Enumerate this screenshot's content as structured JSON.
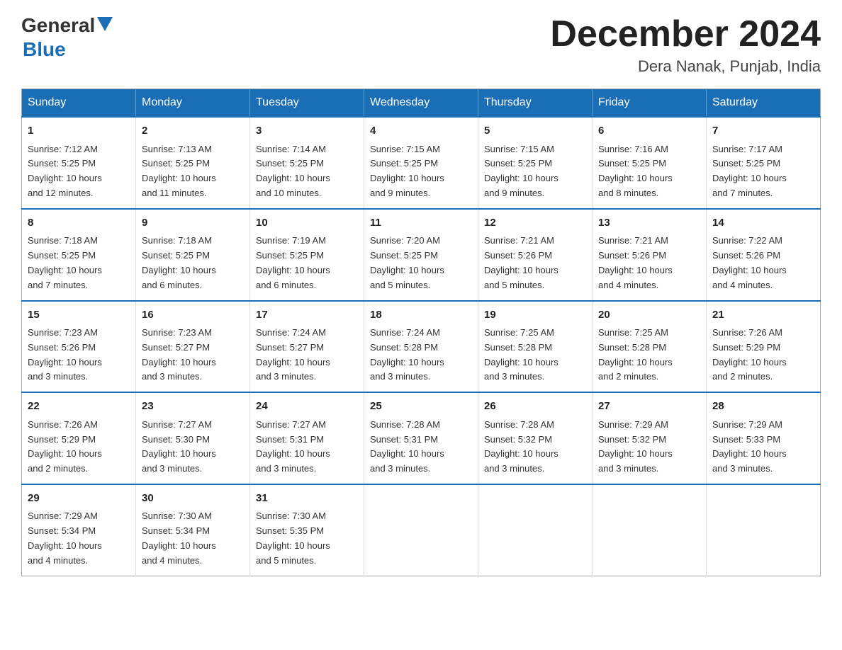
{
  "header": {
    "logo_general": "General",
    "logo_blue": "Blue",
    "month_title": "December 2024",
    "location": "Dera Nanak, Punjab, India"
  },
  "days_of_week": [
    "Sunday",
    "Monday",
    "Tuesday",
    "Wednesday",
    "Thursday",
    "Friday",
    "Saturday"
  ],
  "weeks": [
    [
      {
        "date": "1",
        "sunrise": "7:12 AM",
        "sunset": "5:25 PM",
        "daylight": "10 hours and 12 minutes."
      },
      {
        "date": "2",
        "sunrise": "7:13 AM",
        "sunset": "5:25 PM",
        "daylight": "10 hours and 11 minutes."
      },
      {
        "date": "3",
        "sunrise": "7:14 AM",
        "sunset": "5:25 PM",
        "daylight": "10 hours and 10 minutes."
      },
      {
        "date": "4",
        "sunrise": "7:15 AM",
        "sunset": "5:25 PM",
        "daylight": "10 hours and 9 minutes."
      },
      {
        "date": "5",
        "sunrise": "7:15 AM",
        "sunset": "5:25 PM",
        "daylight": "10 hours and 9 minutes."
      },
      {
        "date": "6",
        "sunrise": "7:16 AM",
        "sunset": "5:25 PM",
        "daylight": "10 hours and 8 minutes."
      },
      {
        "date": "7",
        "sunrise": "7:17 AM",
        "sunset": "5:25 PM",
        "daylight": "10 hours and 7 minutes."
      }
    ],
    [
      {
        "date": "8",
        "sunrise": "7:18 AM",
        "sunset": "5:25 PM",
        "daylight": "10 hours and 7 minutes."
      },
      {
        "date": "9",
        "sunrise": "7:18 AM",
        "sunset": "5:25 PM",
        "daylight": "10 hours and 6 minutes."
      },
      {
        "date": "10",
        "sunrise": "7:19 AM",
        "sunset": "5:25 PM",
        "daylight": "10 hours and 6 minutes."
      },
      {
        "date": "11",
        "sunrise": "7:20 AM",
        "sunset": "5:25 PM",
        "daylight": "10 hours and 5 minutes."
      },
      {
        "date": "12",
        "sunrise": "7:21 AM",
        "sunset": "5:26 PM",
        "daylight": "10 hours and 5 minutes."
      },
      {
        "date": "13",
        "sunrise": "7:21 AM",
        "sunset": "5:26 PM",
        "daylight": "10 hours and 4 minutes."
      },
      {
        "date": "14",
        "sunrise": "7:22 AM",
        "sunset": "5:26 PM",
        "daylight": "10 hours and 4 minutes."
      }
    ],
    [
      {
        "date": "15",
        "sunrise": "7:23 AM",
        "sunset": "5:26 PM",
        "daylight": "10 hours and 3 minutes."
      },
      {
        "date": "16",
        "sunrise": "7:23 AM",
        "sunset": "5:27 PM",
        "daylight": "10 hours and 3 minutes."
      },
      {
        "date": "17",
        "sunrise": "7:24 AM",
        "sunset": "5:27 PM",
        "daylight": "10 hours and 3 minutes."
      },
      {
        "date": "18",
        "sunrise": "7:24 AM",
        "sunset": "5:28 PM",
        "daylight": "10 hours and 3 minutes."
      },
      {
        "date": "19",
        "sunrise": "7:25 AM",
        "sunset": "5:28 PM",
        "daylight": "10 hours and 3 minutes."
      },
      {
        "date": "20",
        "sunrise": "7:25 AM",
        "sunset": "5:28 PM",
        "daylight": "10 hours and 2 minutes."
      },
      {
        "date": "21",
        "sunrise": "7:26 AM",
        "sunset": "5:29 PM",
        "daylight": "10 hours and 2 minutes."
      }
    ],
    [
      {
        "date": "22",
        "sunrise": "7:26 AM",
        "sunset": "5:29 PM",
        "daylight": "10 hours and 2 minutes."
      },
      {
        "date": "23",
        "sunrise": "7:27 AM",
        "sunset": "5:30 PM",
        "daylight": "10 hours and 3 minutes."
      },
      {
        "date": "24",
        "sunrise": "7:27 AM",
        "sunset": "5:31 PM",
        "daylight": "10 hours and 3 minutes."
      },
      {
        "date": "25",
        "sunrise": "7:28 AM",
        "sunset": "5:31 PM",
        "daylight": "10 hours and 3 minutes."
      },
      {
        "date": "26",
        "sunrise": "7:28 AM",
        "sunset": "5:32 PM",
        "daylight": "10 hours and 3 minutes."
      },
      {
        "date": "27",
        "sunrise": "7:29 AM",
        "sunset": "5:32 PM",
        "daylight": "10 hours and 3 minutes."
      },
      {
        "date": "28",
        "sunrise": "7:29 AM",
        "sunset": "5:33 PM",
        "daylight": "10 hours and 3 minutes."
      }
    ],
    [
      {
        "date": "29",
        "sunrise": "7:29 AM",
        "sunset": "5:34 PM",
        "daylight": "10 hours and 4 minutes."
      },
      {
        "date": "30",
        "sunrise": "7:30 AM",
        "sunset": "5:34 PM",
        "daylight": "10 hours and 4 minutes."
      },
      {
        "date": "31",
        "sunrise": "7:30 AM",
        "sunset": "5:35 PM",
        "daylight": "10 hours and 5 minutes."
      },
      null,
      null,
      null,
      null
    ]
  ],
  "labels": {
    "sunrise": "Sunrise:",
    "sunset": "Sunset:",
    "daylight": "Daylight:"
  }
}
